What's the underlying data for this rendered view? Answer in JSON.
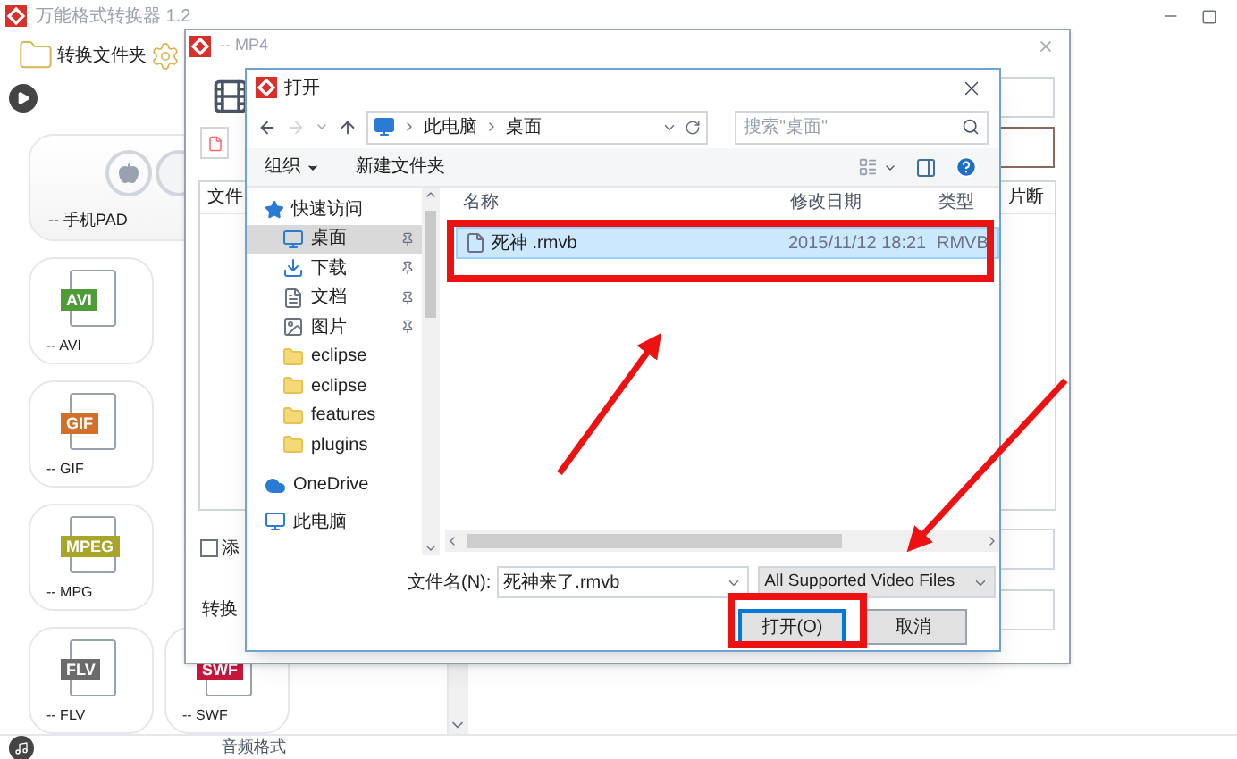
{
  "app": {
    "title": "万能格式转换器 1.2",
    "folder_label": "转换文件夹",
    "cards": [
      {
        "kind": "device",
        "label": "-- 手机PAD"
      },
      {
        "kind": "format",
        "badge": "AVI",
        "color": "#4e9b37",
        "label": "-- AVI"
      },
      {
        "kind": "format",
        "badge": "GIF",
        "color": "#d0702a",
        "label": "-- GIF"
      },
      {
        "kind": "format",
        "badge": "MPEG",
        "color": "#a7a52a",
        "label": "-- MPG"
      },
      {
        "kind": "format",
        "badge": "FLV",
        "color": "#6b6b6b",
        "label": "-- FLV"
      },
      {
        "kind": "format",
        "badge": "SWF",
        "color": "#c8153b",
        "label": "-- SWF"
      }
    ],
    "footer_label": "音频格式"
  },
  "mp4_window": {
    "title": "-- MP4",
    "list_header": "文件",
    "side_header": "片断",
    "checkbox": {
      "label": "添",
      "checked": false
    },
    "convert_label": "转换"
  },
  "open_dialog": {
    "title": "打开",
    "path": [
      "此电脑",
      "桌面"
    ],
    "search": {
      "placeholder": "搜索\"桌面\""
    },
    "toolbar": [
      "组织",
      "新建文件夹"
    ],
    "nav": [
      {
        "label": "快速访问",
        "kind": "star",
        "selected": false,
        "children": [
          {
            "label": "桌面",
            "kind": "desktop",
            "pinned": true,
            "selected": true
          },
          {
            "label": "下载",
            "kind": "download",
            "pinned": true,
            "selected": false
          },
          {
            "label": "文档",
            "kind": "document",
            "pinned": true,
            "selected": false
          },
          {
            "label": "图片",
            "kind": "picture",
            "pinned": true,
            "selected": false
          },
          {
            "label": "eclipse",
            "kind": "folder",
            "pinned": false,
            "selected": false
          },
          {
            "label": "eclipse",
            "kind": "folder",
            "pinned": false,
            "selected": false
          },
          {
            "label": "features",
            "kind": "folder",
            "pinned": false,
            "selected": false
          },
          {
            "label": "plugins",
            "kind": "folder",
            "pinned": false,
            "selected": false
          }
        ]
      },
      {
        "label": "OneDrive",
        "kind": "cloud",
        "selected": false
      },
      {
        "label": "此电脑",
        "kind": "computer",
        "selected": false
      }
    ],
    "columns": [
      "名称",
      "修改日期",
      "类型"
    ],
    "rows": [
      {
        "name": "死神 .rmvb",
        "modified": "2015/11/12 18:21",
        "type": "RMVB",
        "selected": true
      }
    ],
    "filename_label": "文件名(N):",
    "filename": "死神来了.rmvb",
    "filter": "All Supported Video Files",
    "buttons": [
      {
        "label": "打开(O)",
        "kind": "primary"
      },
      {
        "label": "取消",
        "kind": "secondary"
      }
    ]
  }
}
